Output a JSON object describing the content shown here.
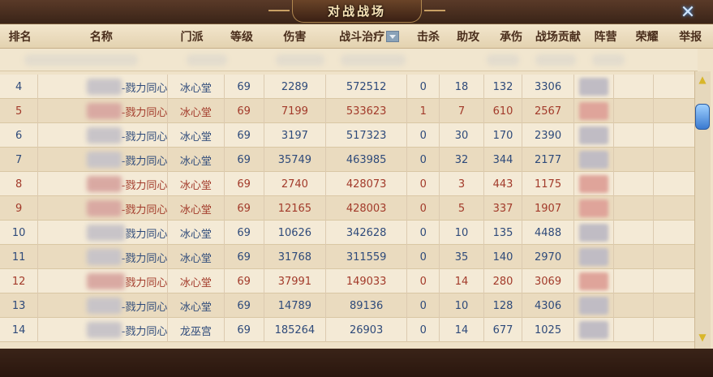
{
  "window": {
    "title": "对战战场",
    "close_icon": "close-x-icon"
  },
  "columns": [
    {
      "key": "rank",
      "label": "排名"
    },
    {
      "key": "name",
      "label": "名称"
    },
    {
      "key": "school",
      "label": "门派"
    },
    {
      "key": "level",
      "label": "等级"
    },
    {
      "key": "damage",
      "label": "伤害"
    },
    {
      "key": "heal",
      "label": "战斗治疗"
    },
    {
      "key": "kills",
      "label": "击杀"
    },
    {
      "key": "assists",
      "label": "助攻"
    },
    {
      "key": "taken",
      "label": "承伤"
    },
    {
      "key": "contribution",
      "label": "战场贡献"
    },
    {
      "key": "faction",
      "label": "阵营"
    },
    {
      "key": "honor",
      "label": "荣耀"
    },
    {
      "key": "report",
      "label": "举报"
    }
  ],
  "rows": [
    {
      "rank": "4",
      "name": "-戮力同心",
      "school": "冰心堂",
      "level": "69",
      "damage": "2289",
      "heal": "572512",
      "kills": "0",
      "assists": "18",
      "taken": "132",
      "contribution": "3306",
      "red": false
    },
    {
      "rank": "5",
      "name": "-戮力同心",
      "school": "冰心堂",
      "level": "69",
      "damage": "7199",
      "heal": "533623",
      "kills": "1",
      "assists": "7",
      "taken": "610",
      "contribution": "2567",
      "red": true
    },
    {
      "rank": "6",
      "name": "-戮力同心",
      "school": "冰心堂",
      "level": "69",
      "damage": "3197",
      "heal": "517323",
      "kills": "0",
      "assists": "30",
      "taken": "170",
      "contribution": "2390",
      "red": false
    },
    {
      "rank": "7",
      "name": "-戮力同心",
      "school": "冰心堂",
      "level": "69",
      "damage": "35749",
      "heal": "463985",
      "kills": "0",
      "assists": "32",
      "taken": "344",
      "contribution": "2177",
      "red": false
    },
    {
      "rank": "8",
      "name": "-戮力同心",
      "school": "冰心堂",
      "level": "69",
      "damage": "2740",
      "heal": "428073",
      "kills": "0",
      "assists": "3",
      "taken": "443",
      "contribution": "1175",
      "red": true
    },
    {
      "rank": "9",
      "name": "-戮力同心",
      "school": "冰心堂",
      "level": "69",
      "damage": "12165",
      "heal": "428003",
      "kills": "0",
      "assists": "5",
      "taken": "337",
      "contribution": "1907",
      "red": true
    },
    {
      "rank": "10",
      "name": "戮力同心",
      "school": "冰心堂",
      "level": "69",
      "damage": "10626",
      "heal": "342628",
      "kills": "0",
      "assists": "10",
      "taken": "135",
      "contribution": "4488",
      "red": false
    },
    {
      "rank": "11",
      "name": "-戮力同心",
      "school": "冰心堂",
      "level": "69",
      "damage": "31768",
      "heal": "311559",
      "kills": "0",
      "assists": "35",
      "taken": "140",
      "contribution": "2970",
      "red": false
    },
    {
      "rank": "12",
      "name": "戮力同心",
      "school": "冰心堂",
      "level": "69",
      "damage": "37991",
      "heal": "149033",
      "kills": "0",
      "assists": "14",
      "taken": "280",
      "contribution": "3069",
      "red": true
    },
    {
      "rank": "13",
      "name": "-戮力同心",
      "school": "冰心堂",
      "level": "69",
      "damage": "14789",
      "heal": "89136",
      "kills": "0",
      "assists": "10",
      "taken": "128",
      "contribution": "4306",
      "red": false
    },
    {
      "rank": "14",
      "name": "-戮力同心",
      "school": "龙巫宫",
      "level": "69",
      "damage": "185264",
      "heal": "26903",
      "kills": "0",
      "assists": "14",
      "taken": "677",
      "contribution": "1025",
      "red": false
    }
  ],
  "scrollbar": {
    "up_icon": "scroll-up-arrow-icon",
    "down_icon": "scroll-down-arrow-icon"
  },
  "colors": {
    "ally_text": "#2e4a7a",
    "enemy_text": "#a23a2a",
    "header_text": "#4a2e1c"
  }
}
